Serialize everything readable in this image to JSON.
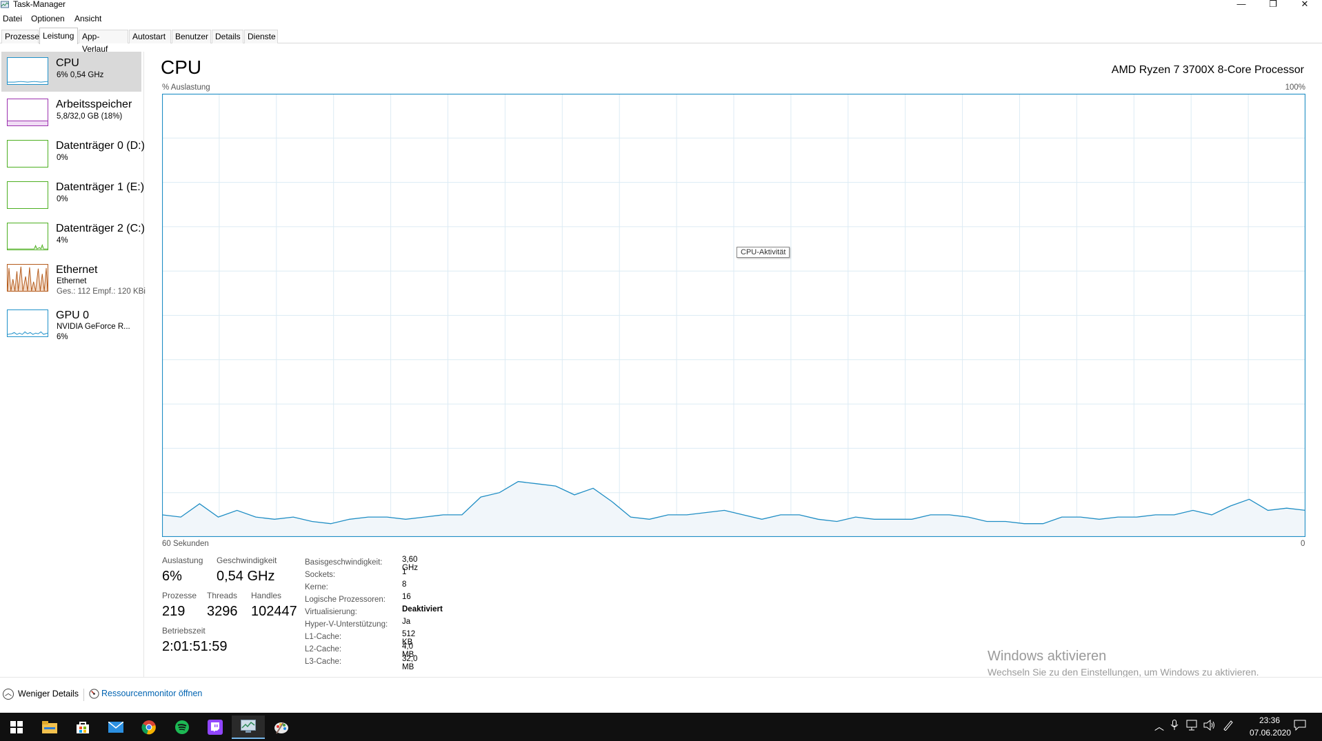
{
  "window": {
    "title": "Task-Manager",
    "controls": {
      "minimize": "—",
      "restore": "❐",
      "close": "✕"
    }
  },
  "menu": [
    "Datei",
    "Optionen",
    "Ansicht"
  ],
  "tabs": [
    "Prozesse",
    "Leistung",
    "App-Verlauf",
    "Autostart",
    "Benutzer",
    "Details",
    "Dienste"
  ],
  "active_tab": "Leistung",
  "sidebar": {
    "items": [
      {
        "title": "CPU",
        "line1": "6% 0,54 GHz",
        "line2": "",
        "color": "#1e90c9"
      },
      {
        "title": "Arbeitsspeicher",
        "line1": "5,8/32,0 GB (18%)",
        "line2": "",
        "color": "#9b2fae"
      },
      {
        "title": "Datenträger 0 (D:)",
        "line1": "0%",
        "line2": "",
        "color": "#4caf1f"
      },
      {
        "title": "Datenträger 1 (E:)",
        "line1": "0%",
        "line2": "",
        "color": "#4caf1f"
      },
      {
        "title": "Datenträger 2 (C:)",
        "line1": "4%",
        "line2": "",
        "color": "#4caf1f"
      },
      {
        "title": "Ethernet",
        "line1": "Ethernet",
        "line2": "Ges.: 112  Empf.: 120 KBi",
        "color": "#b45a1a"
      },
      {
        "title": "GPU 0",
        "line1": "NVIDIA GeForce R...",
        "line2": "6%",
        "color": "#1e90c9"
      }
    ]
  },
  "main": {
    "title": "CPU",
    "processor": "AMD Ryzen 7 3700X 8-Core Processor",
    "y_label": "% Auslastung",
    "y_max_label": "100%",
    "x_label": "60 Sekunden",
    "x_min_label": "0",
    "tooltip": "CPU-Aktivität",
    "stats": {
      "auslastung_label": "Auslastung",
      "auslastung": "6%",
      "geschwindigkeit_label": "Geschwindigkeit",
      "geschwindigkeit": "0,54 GHz",
      "prozesse_label": "Prozesse",
      "prozesse": "219",
      "threads_label": "Threads",
      "threads": "3296",
      "handles_label": "Handles",
      "handles": "102447",
      "betriebszeit_label": "Betriebszeit",
      "betriebszeit": "2:01:51:59"
    },
    "specs": [
      {
        "k": "Basisgeschwindigkeit:",
        "v": "3,60 GHz"
      },
      {
        "k": "Sockets:",
        "v": "1"
      },
      {
        "k": "Kerne:",
        "v": "8"
      },
      {
        "k": "Logische Prozessoren:",
        "v": "16"
      },
      {
        "k": "Virtualisierung:",
        "v": "Deaktiviert",
        "bold": true
      },
      {
        "k": "Hyper-V-Unterstützung:",
        "v": "Ja"
      },
      {
        "k": "L1-Cache:",
        "v": "512 KB"
      },
      {
        "k": "L2-Cache:",
        "v": "4,0 MB"
      },
      {
        "k": "L3-Cache:",
        "v": "32,0 MB"
      }
    ]
  },
  "chart_data": {
    "type": "area",
    "title": "",
    "xlabel": "60 Sekunden",
    "ylabel": "% Auslastung",
    "ylim": [
      0,
      100
    ],
    "xlim": [
      60,
      0
    ],
    "grid": true,
    "series": [
      {
        "values": [
          5,
          4.5,
          7.5,
          4.5,
          6,
          4.5,
          4,
          4.5,
          3.5,
          3,
          4,
          4.5,
          4.5,
          4,
          4.5,
          5,
          5,
          9,
          10,
          12.5,
          12,
          11.5,
          9.5,
          11,
          8,
          4.5,
          4,
          5,
          5,
          5.5,
          6,
          5,
          4,
          5,
          5,
          4,
          3.5,
          4.5,
          4,
          4,
          4,
          5,
          5,
          4.5,
          3.5,
          3.5,
          3,
          3,
          4.5,
          4.5,
          4,
          4.5,
          4.5,
          5,
          5,
          6,
          5,
          7,
          8.5,
          6,
          6.5,
          6
        ]
      }
    ]
  },
  "footer": {
    "less_details": "Weniger Details",
    "resource_monitor": "Ressourcenmonitor öffnen"
  },
  "watermark": {
    "title": "Windows aktivieren",
    "subtitle": "Wechseln Sie zu den Einstellungen, um Windows zu aktivieren."
  },
  "taskbar": {
    "icons": [
      "windows-start-icon",
      "file-explorer-icon",
      "microsoft-store-icon",
      "mail-icon",
      "chrome-icon",
      "spotify-icon",
      "twitch-icon",
      "task-manager-icon",
      "paint-icon"
    ],
    "time": "23:36",
    "date": "07.06.2020"
  }
}
